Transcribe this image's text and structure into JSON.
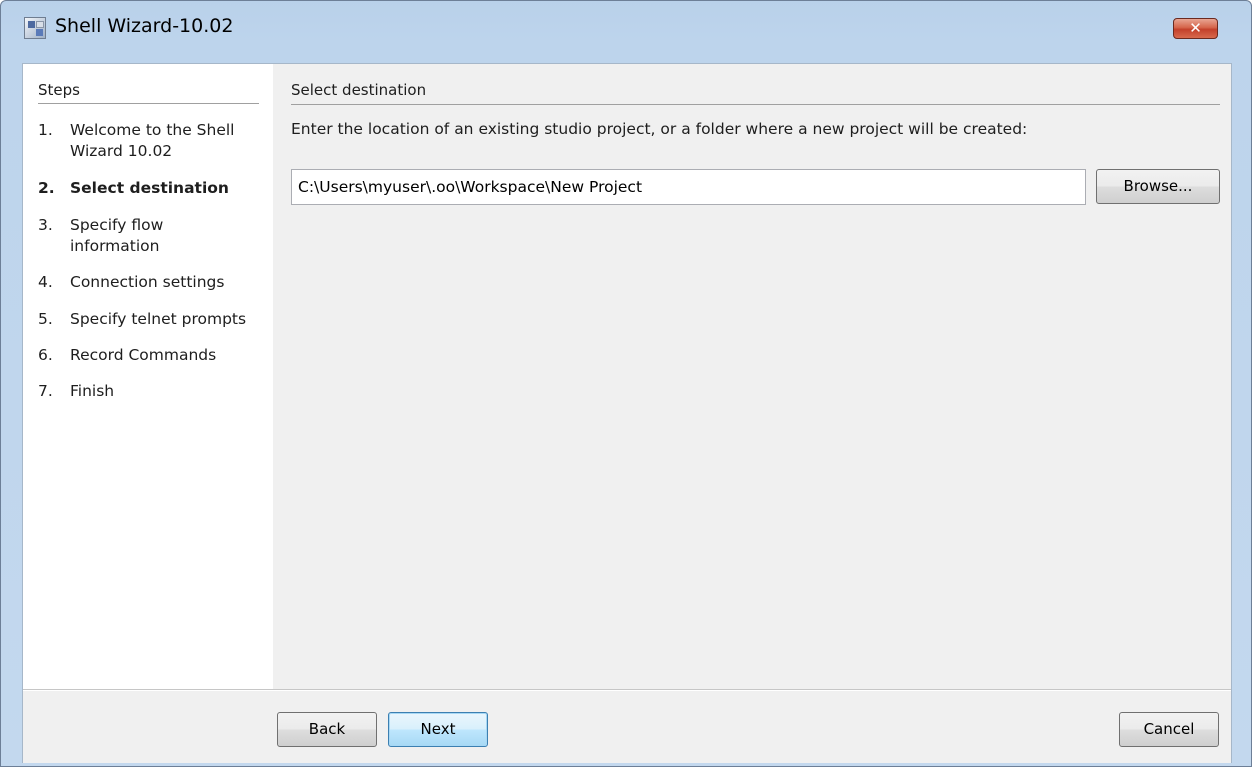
{
  "window": {
    "title": "Shell Wizard-10.02",
    "close_label": "✕"
  },
  "sidebar": {
    "heading": "Steps",
    "steps": [
      {
        "num": "1.",
        "label": "Welcome to the Shell Wizard 10.02",
        "active": false
      },
      {
        "num": "2.",
        "label": "Select destination",
        "active": true
      },
      {
        "num": "3.",
        "label": "Specify flow information",
        "active": false
      },
      {
        "num": "4.",
        "label": "Connection settings",
        "active": false
      },
      {
        "num": "5.",
        "label": "Specify telnet prompts",
        "active": false
      },
      {
        "num": "6.",
        "label": "Record Commands",
        "active": false
      },
      {
        "num": "7.",
        "label": "Finish",
        "active": false
      }
    ]
  },
  "main": {
    "heading": "Select destination",
    "instruction": "Enter the location of an existing studio project, or a folder where a new project will be created:",
    "path_value": "C:\\Users\\myuser\\.oo\\Workspace\\New Project",
    "browse_label": "Browse..."
  },
  "footer": {
    "back_label": "Back",
    "next_label": "Next",
    "cancel_label": "Cancel"
  }
}
